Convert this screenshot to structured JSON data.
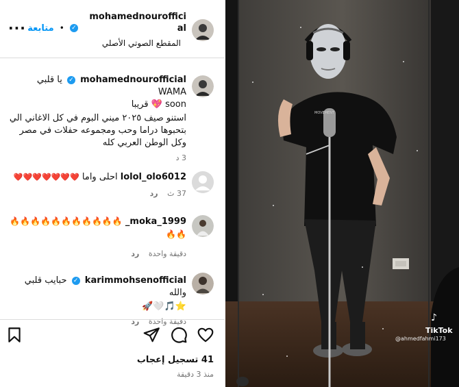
{
  "header": {
    "username": "mohamednourofficial",
    "follow_label": "متابعة",
    "dot": "•",
    "audio_label": "المقطع الصوتي الأصلي",
    "more_label": "..."
  },
  "caption": {
    "username": "mohamednourofficial",
    "text_line1": "يا قلبي WAMA",
    "text_line2": "soon",
    "text_line2b": "قريبا",
    "body": "استنو صيف ٢٠٢٥ ميني البوم في كل الاغاني الي بتحبوها دراما وحب ومجموعه حفلات في مصر وكل الوطن العربي كله",
    "time": "3 د"
  },
  "comments": [
    {
      "username": "lolol_olo6012",
      "text": "احلى واما",
      "emoji": "❤️❤️❤️❤️❤️❤️❤️",
      "time": "37 ث",
      "reply": "رد"
    },
    {
      "username": "moka_1999_",
      "text": "🔥🔥🔥🔥🔥🔥🔥🔥🔥🔥🔥🔥🔥",
      "time": "دقيقة واحدة",
      "reply": "رد"
    },
    {
      "username": "karimmohsenofficial",
      "text": "حبايب قلبي والله",
      "emoji": "⭐🎵🤍🚀",
      "time": "دقيقة واحدة",
      "reply": "رد"
    }
  ],
  "footer": {
    "likes": "41 تسجيل إعجاب",
    "time": "منذ 3 دقيقة"
  },
  "media": {
    "watermark": "TikTok",
    "handle": "@ahmedfahmi173",
    "mic_brand": "MOVEMENT"
  },
  "icons": {
    "verified": "verified-badge-icon",
    "like": "heart-icon",
    "comment": "comment-icon",
    "share": "send-icon",
    "save": "bookmark-icon"
  }
}
